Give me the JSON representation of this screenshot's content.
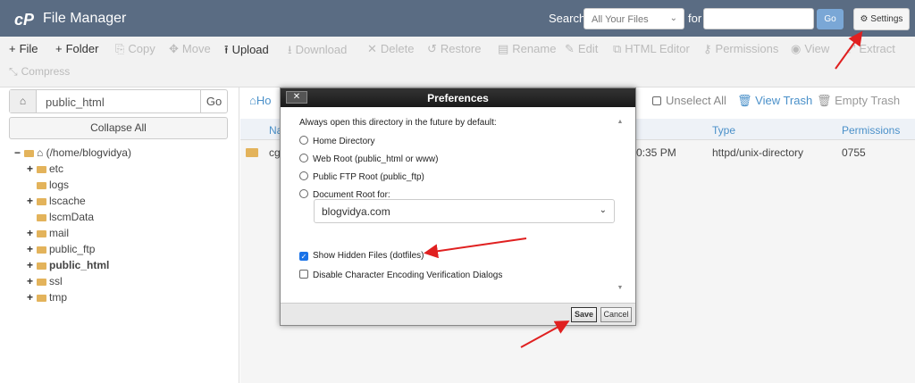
{
  "header": {
    "logo": "cP",
    "title": "File Manager",
    "search_label": "Search",
    "search_scope": "All Your Files",
    "for_label": "for",
    "go": "Go",
    "settings": "Settings"
  },
  "toolbar": {
    "items": [
      {
        "label": "File",
        "icon": "+",
        "on": true
      },
      {
        "label": "Folder",
        "icon": "+",
        "on": true
      },
      {
        "label": "Copy",
        "icon": "⎘",
        "on": false
      },
      {
        "label": "Move",
        "icon": "✥",
        "on": false
      },
      {
        "label": "Upload",
        "icon": "⭱",
        "on": true
      },
      {
        "label": "Download",
        "icon": "⭳",
        "on": false
      },
      {
        "label": "Delete",
        "icon": "✕",
        "on": false
      },
      {
        "label": "Restore",
        "icon": "↺",
        "on": false
      },
      {
        "label": "Rename",
        "icon": "▤",
        "on": false
      },
      {
        "label": "Edit",
        "icon": "✎",
        "on": false
      },
      {
        "label": "HTML Editor",
        "icon": "⧉",
        "on": false
      },
      {
        "label": "Permissions",
        "icon": "⚷",
        "on": false
      },
      {
        "label": "View",
        "icon": "◉",
        "on": false
      },
      {
        "label": "Extract",
        "icon": "⤢",
        "on": false
      },
      {
        "label": "Compress",
        "icon": "⤡",
        "on": false
      }
    ]
  },
  "left": {
    "path": "public_html",
    "go": "Go",
    "collapse": "Collapse All",
    "tree": [
      {
        "label": "(/home/blogvidya)",
        "pm": "−",
        "home": true
      },
      {
        "label": "etc",
        "pm": "+"
      },
      {
        "label": "logs",
        "pm": ""
      },
      {
        "label": "lscache",
        "pm": "+"
      },
      {
        "label": "lscmData",
        "pm": ""
      },
      {
        "label": "mail",
        "pm": "+"
      },
      {
        "label": "public_ftp",
        "pm": "+"
      },
      {
        "label": "public_html",
        "pm": "+",
        "bold": true
      },
      {
        "label": "ssl",
        "pm": "+"
      },
      {
        "label": "tmp",
        "pm": "+"
      }
    ]
  },
  "right": {
    "home": "Ho",
    "unselect_all": "Unselect All",
    "view_trash": "View Trash",
    "empty_trash": "Empty Trash",
    "columns": {
      "name": "Na",
      "type": "Type",
      "permissions": "Permissions"
    },
    "row": {
      "name": "cg",
      "modified": "0:35 PM",
      "type": "httpd/unix-directory",
      "permissions": "0755"
    }
  },
  "modal": {
    "title": "Preferences",
    "close": "✕",
    "intro": "Always open this directory in the future by default:",
    "radios": [
      "Home Directory",
      "Web Root (public_html or www)",
      "Public FTP Root (public_ftp)",
      "Document Root for:"
    ],
    "domain": "blogvidya.com",
    "show_hidden": "Show Hidden Files (dotfiles)",
    "disable_enc": "Disable Character Encoding Verification Dialogs",
    "save": "Save",
    "cancel": "Cancel"
  }
}
